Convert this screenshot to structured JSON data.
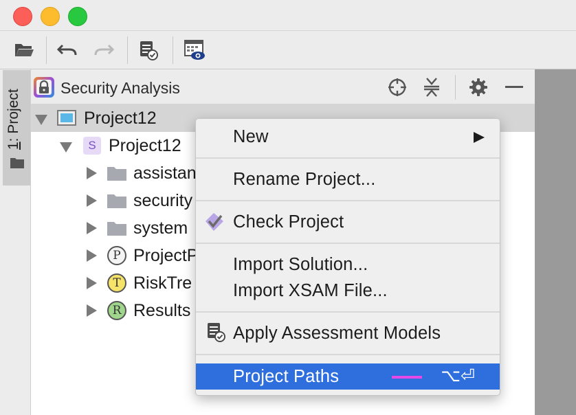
{
  "window": {
    "traffic_lights": [
      "close",
      "minimize",
      "maximize"
    ]
  },
  "toolbar": {
    "buttons": [
      {
        "name": "open-folder-icon"
      },
      {
        "name": "undo-icon"
      },
      {
        "name": "redo-icon"
      },
      {
        "name": "apply-models-icon"
      },
      {
        "name": "calendar-view-icon"
      }
    ]
  },
  "left_tool_window_tab": {
    "number": "1",
    "label": ": Project"
  },
  "panel": {
    "title": "Security Analysis",
    "header_icons": [
      "locate-icon",
      "collapse-all-icon",
      "gear-icon",
      "minimize-icon"
    ]
  },
  "tree": {
    "root": {
      "label": "Project12",
      "expanded": true
    },
    "solution": {
      "badge": "S",
      "label": "Project12",
      "expanded": true
    },
    "items": [
      {
        "label": "assistan",
        "type": "folder"
      },
      {
        "label": "security",
        "type": "folder"
      },
      {
        "label": "system",
        "type": "folder"
      },
      {
        "label": "ProjectP",
        "type": "badge",
        "badge": "P"
      },
      {
        "label": "RiskTre",
        "type": "badge",
        "badge": "T"
      },
      {
        "label": "Results",
        "type": "badge",
        "badge": "R"
      }
    ]
  },
  "context_menu": {
    "new": "New",
    "rename": "Rename Project...",
    "check": "Check Project",
    "import_solution": "Import Solution...",
    "import_xsam": "Import XSAM File...",
    "apply_models": "Apply Assessment Models",
    "project_paths": "Project Paths",
    "project_paths_shortcut": "⌥⏎",
    "highlight_color": "#2f6fdd"
  }
}
